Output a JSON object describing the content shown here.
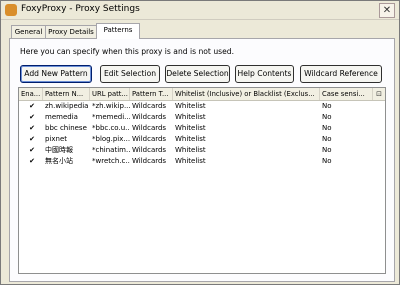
{
  "window": {
    "title": "FoxyProxy - Proxy Settings",
    "close_glyph": "✕"
  },
  "tabs": [
    {
      "label": "General",
      "active": false
    },
    {
      "label": "Proxy Details",
      "active": false
    },
    {
      "label": "Patterns",
      "active": true
    }
  ],
  "description": "Here you can specify when this proxy is and is not used.",
  "buttons": {
    "add": "Add New Pattern",
    "edit": "Edit Selection",
    "delete": "Delete Selection",
    "help": "Help Contents",
    "wildcard": "Wildcard Reference"
  },
  "table": {
    "headers": [
      "Ena...",
      "Pattern N...",
      "URL patt...",
      "Pattern T...",
      "Whitelist (Inclusive) or Blacklist (Exclus...",
      "Case sensi..."
    ],
    "column_picker_glyph": "⊡",
    "rows": [
      {
        "enabled": "✔",
        "name": "zh.wikipedia",
        "url": "*zh.wikip...",
        "type": "Wildcards",
        "list": "Whitelist",
        "case": "No"
      },
      {
        "enabled": "✔",
        "name": "memedia",
        "url": "*memedi...",
        "type": "Wildcards",
        "list": "Whitelist",
        "case": "No"
      },
      {
        "enabled": "✔",
        "name": "bbc chinese",
        "url": "*bbc.co.u...",
        "type": "Wildcards",
        "list": "Whitelist",
        "case": "No"
      },
      {
        "enabled": "✔",
        "name": "pixnet",
        "url": "*blog.pix...",
        "type": "Wildcards",
        "list": "Whitelist",
        "case": "No"
      },
      {
        "enabled": "✔",
        "name": "中國時報",
        "url": "*chinatim...",
        "type": "Wildcards",
        "list": "Whitelist",
        "case": "No"
      },
      {
        "enabled": "✔",
        "name": "無名小站",
        "url": "*wretch.c...",
        "type": "Wildcards",
        "list": "Whitelist",
        "case": "No"
      }
    ]
  }
}
